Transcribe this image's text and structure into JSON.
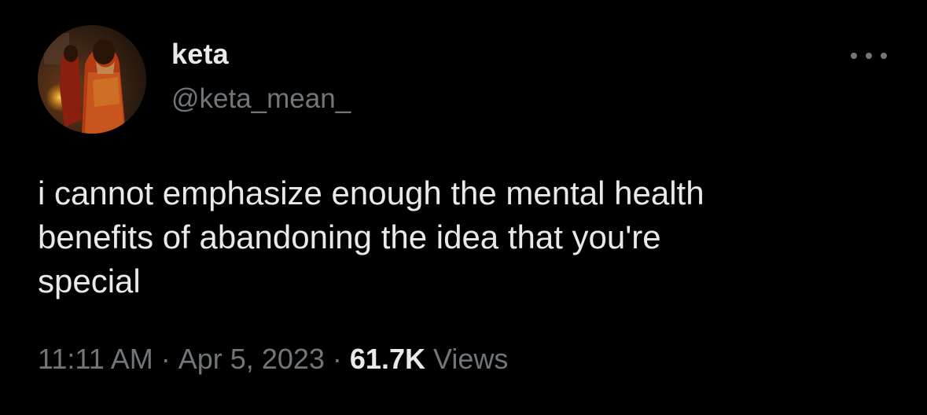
{
  "author": {
    "display_name": "keta",
    "handle": "@keta_mean_",
    "avatar_icon": "profile-photo"
  },
  "more_icon": "more-horizontal-icon",
  "tweet": {
    "text": "i cannot emphasize enough the mental health\nbenefits of abandoning the idea that you're\nspecial"
  },
  "meta": {
    "time": "11:11 AM",
    "separator": "·",
    "date": "Apr 5, 2023",
    "views_count": "61.7K",
    "views_label": "Views"
  },
  "colors": {
    "background": "#000000",
    "primary_text": "#e7e9ea",
    "secondary_text": "#71767b"
  }
}
